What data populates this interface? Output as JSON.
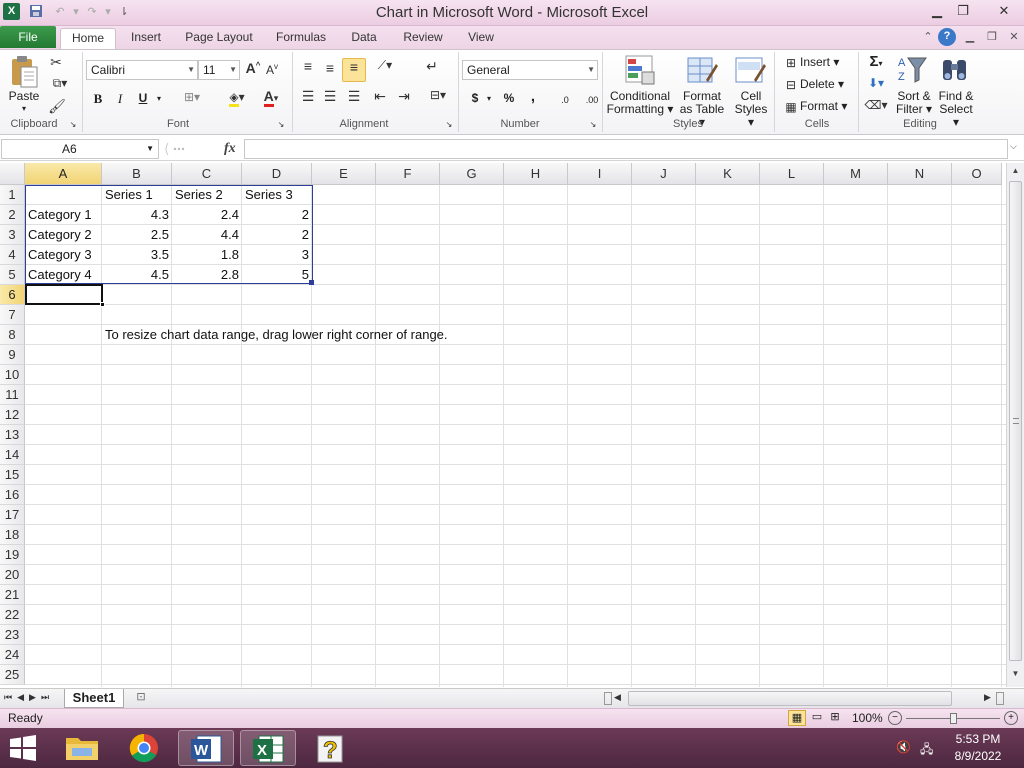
{
  "window": {
    "title": "Chart in Microsoft Word  -  Microsoft Excel",
    "app_icon": "X",
    "controls": {
      "minimize": "▁",
      "restore": "❐",
      "close": "✕"
    }
  },
  "ribbon_tabs": [
    {
      "label": "File"
    },
    {
      "label": "Home"
    },
    {
      "label": "Insert"
    },
    {
      "label": "Page Layout"
    },
    {
      "label": "Formulas"
    },
    {
      "label": "Data"
    },
    {
      "label": "Review"
    },
    {
      "label": "View"
    }
  ],
  "ribbon": {
    "clipboard": {
      "paste": "Paste",
      "group": "Clipboard"
    },
    "font": {
      "name": "Calibri",
      "size": "11",
      "bold": "B",
      "italic": "I",
      "underline": "U",
      "group": "Font",
      "grow": "A",
      "shrink": "A",
      "font_color_glyph": "A"
    },
    "alignment": {
      "group": "Alignment"
    },
    "number": {
      "format": "General",
      "currency": "$",
      "percent": "%",
      "comma": ",",
      "group": "Number",
      "inc_decimal": ".0",
      "dec_decimal": ".00"
    },
    "styles": {
      "conditional_1": "Conditional",
      "conditional_2": "Formatting",
      "format_table_1": "Format",
      "format_table_2": "as Table",
      "cell_styles_1": "Cell",
      "cell_styles_2": "Styles",
      "group": "Styles"
    },
    "cells": {
      "insert": "Insert",
      "delete": "Delete",
      "format": "Format",
      "group": "Cells"
    },
    "editing": {
      "sum": "Σ",
      "sort_1": "Sort &",
      "sort_2": "Filter",
      "find_1": "Find &",
      "find_2": "Select",
      "group": "Editing"
    }
  },
  "formula_bar": {
    "name_box": "A6",
    "fx": "fx",
    "formula": ""
  },
  "columns": [
    "A",
    "B",
    "C",
    "D",
    "E",
    "F",
    "G",
    "H",
    "I",
    "J",
    "K",
    "L",
    "M",
    "N",
    "O"
  ],
  "rows": [
    "1",
    "2",
    "3",
    "4",
    "5",
    "6",
    "7",
    "8",
    "9",
    "10",
    "11",
    "12",
    "13",
    "14",
    "15",
    "16",
    "17",
    "18",
    "19",
    "20",
    "21",
    "22",
    "23",
    "24",
    "25"
  ],
  "table": {
    "headers": [
      "Series 1",
      "Series 2",
      "Series 3"
    ],
    "rows": [
      {
        "category": "Category 1",
        "values": [
          "4.3",
          "2.4",
          "2"
        ]
      },
      {
        "category": "Category 2",
        "values": [
          "2.5",
          "4.4",
          "2"
        ]
      },
      {
        "category": "Category 3",
        "values": [
          "3.5",
          "1.8",
          "3"
        ]
      },
      {
        "category": "Category 4",
        "values": [
          "4.5",
          "2.8",
          "5"
        ]
      }
    ]
  },
  "hint_text": "To resize chart data range, drag lower right corner of range.",
  "sheets": {
    "active": "Sheet1"
  },
  "status": {
    "ready": "Ready",
    "zoom": "100%"
  },
  "taskbar": {
    "time": "5:53 PM",
    "date": "8/9/2022"
  }
}
